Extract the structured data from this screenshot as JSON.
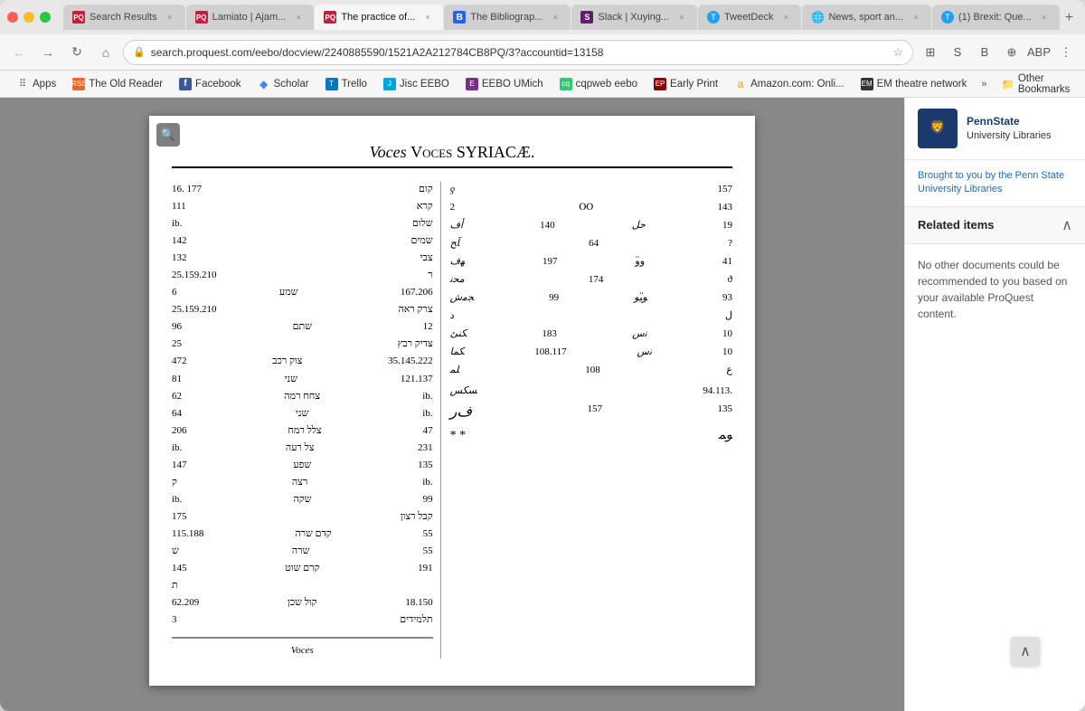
{
  "browser": {
    "traffic_lights": [
      "red",
      "yellow",
      "green"
    ],
    "tabs": [
      {
        "id": "tab1",
        "label": "Search Results",
        "favicon_type": "pq",
        "favicon_text": "PQ",
        "active": false
      },
      {
        "id": "tab2",
        "label": "Lamiato | Ajam...",
        "favicon_type": "pq",
        "favicon_text": "PQ",
        "active": false
      },
      {
        "id": "tab3",
        "label": "The practice of...",
        "favicon_type": "pq",
        "favicon_text": "PQ",
        "active": true
      },
      {
        "id": "tab4",
        "label": "The Bibliograp...",
        "favicon_type": "b",
        "favicon_text": "B",
        "active": false
      },
      {
        "id": "tab5",
        "label": "Slack | Xuying...",
        "favicon_type": "s",
        "favicon_text": "S",
        "active": false
      },
      {
        "id": "tab6",
        "label": "TweetDeck",
        "favicon_type": "t",
        "favicon_text": "T",
        "active": false
      },
      {
        "id": "tab7",
        "label": "News, sport an...",
        "favicon_type": "globe",
        "favicon_text": "🌐",
        "active": false
      },
      {
        "id": "tab8",
        "label": "(1) Brexit: Que...",
        "favicon_type": "t",
        "favicon_text": "T",
        "active": false
      }
    ],
    "new_tab_label": "+",
    "url": "search.proquest.com/eebo/docview/2240885590/1521A2A212784CB8PQ/3?accountid=13158",
    "bookmarks": [
      {
        "label": "Apps",
        "favicon_type": "apps",
        "favicon_text": "⠿"
      },
      {
        "label": "The Old Reader",
        "favicon_type": "rss",
        "favicon_text": "RSS"
      },
      {
        "label": "Facebook",
        "favicon_type": "fb",
        "favicon_text": "f"
      },
      {
        "label": "Scholar",
        "favicon_type": "scholar",
        "favicon_text": "◆"
      },
      {
        "label": "Trello",
        "favicon_type": "trello",
        "favicon_text": "T"
      },
      {
        "label": "Jisc EEBO",
        "favicon_type": "jisc",
        "favicon_text": "J"
      },
      {
        "label": "EEBO UMich",
        "favicon_type": "eebo",
        "favicon_text": "E"
      },
      {
        "label": "cqpweb eebo",
        "favicon_type": "cqp",
        "favicon_text": "C"
      },
      {
        "label": "Early Print",
        "favicon_type": "ep",
        "favicon_text": "EP"
      },
      {
        "label": "Amazon.com: Onli...",
        "favicon_type": "amz",
        "favicon_text": "a"
      },
      {
        "label": "EM theatre network",
        "favicon_type": "em",
        "favicon_text": "EM"
      }
    ],
    "other_bookmarks_label": "Other Bookmarks"
  },
  "document": {
    "title": "Voces SYRIACÆ.",
    "zoom_icon": "🔍",
    "content_description": "Page from historical document showing Syriac vocabulary in Hebrew/Aramaic script with numerical references"
  },
  "sidebar": {
    "logo_text_line1": "PennState",
    "logo_text_line2": "University Libraries",
    "promo_text": "Brought to you by the Penn State University Libraries",
    "related_items_title": "Related items",
    "related_items_collapse_icon": "∧",
    "related_items_body": "No other documents could be recommended to you based on your available ProQuest content."
  },
  "scroll_top": {
    "icon": "∧"
  }
}
